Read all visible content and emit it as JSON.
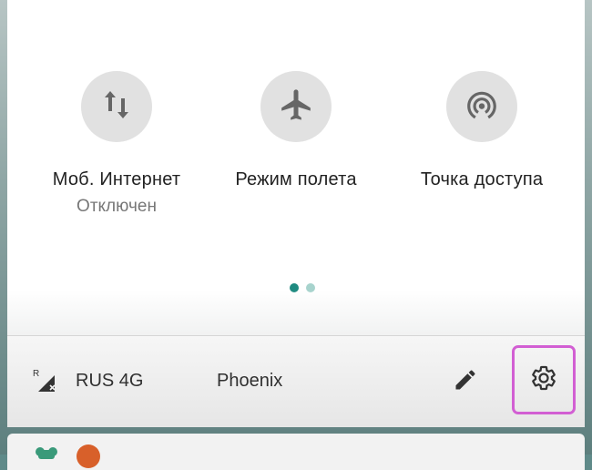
{
  "quick_settings": {
    "tiles": [
      {
        "label": "Моб. Интернет",
        "sublabel": "Отключен",
        "icon": "mobile-data-icon"
      },
      {
        "label": "Режим полета",
        "sublabel": "",
        "icon": "airplane-icon"
      },
      {
        "label": "Точка доступа",
        "sublabel": "",
        "icon": "hotspot-icon"
      }
    ],
    "page_indicator": {
      "pages": 2,
      "active": 0
    }
  },
  "footer": {
    "network_label": "RUS 4G",
    "signal_indicator": "R",
    "wifi_label": "Phoenix",
    "edit_icon": "pencil-icon",
    "settings_icon": "gear-icon"
  },
  "colors": {
    "tile_circle": "#e1e1e1",
    "dot_active": "#1e8a80",
    "dot_inactive": "#a7d3cd",
    "highlight_border": "#d25fd3"
  }
}
